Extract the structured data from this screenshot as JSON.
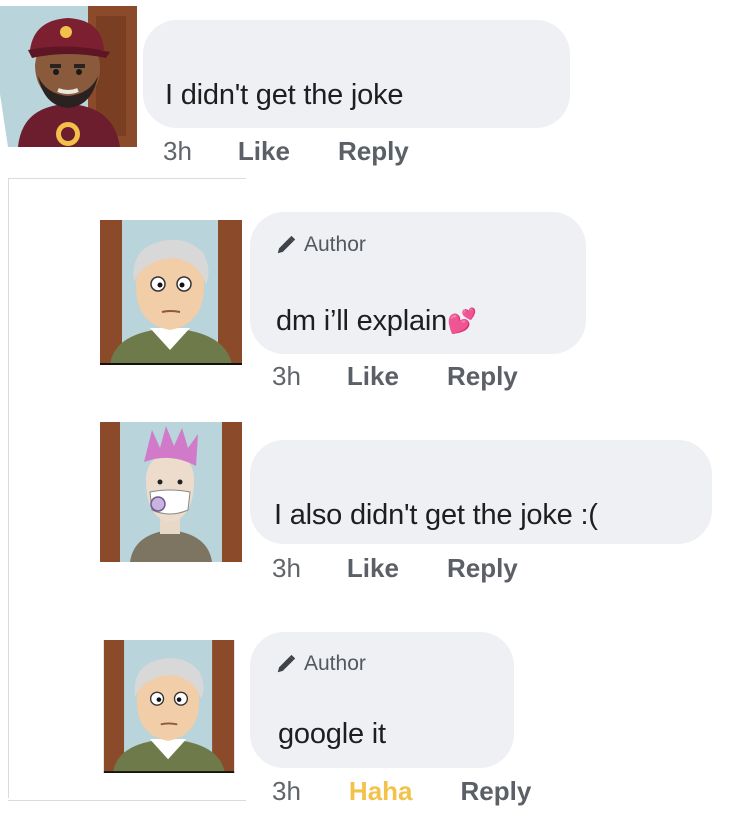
{
  "comments": [
    {
      "text": "I didn't get the joke",
      "time": "3h",
      "like": "Like",
      "reply": "Reply"
    },
    {
      "author_badge": "Author",
      "text": "dm i’ll explain",
      "emoji": "💕",
      "time": "3h",
      "like": "Like",
      "reply": "Reply"
    },
    {
      "text": "I also didn't get the joke :(",
      "time": "3h",
      "like": "Like",
      "reply": "Reply"
    },
    {
      "author_badge": "Author",
      "text": "google it",
      "time": "3h",
      "reaction": "Haha",
      "reply": "Reply"
    }
  ],
  "colors": {
    "bubble": "#eef0f4",
    "haha": "#f3c24a",
    "action": "#5b5f66"
  },
  "icons": {
    "author_badge": "pencil-icon"
  }
}
